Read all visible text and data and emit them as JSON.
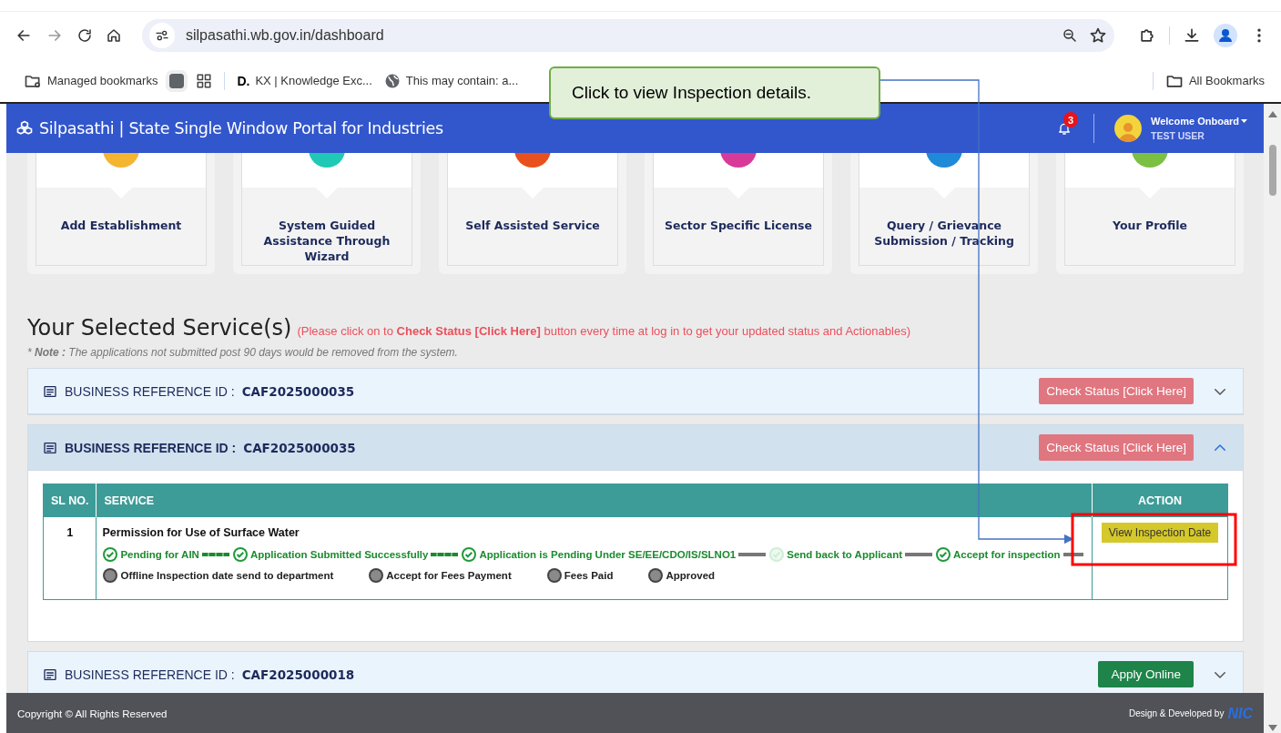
{
  "browser": {
    "url": "silpasathi.wb.gov.in/dashboard",
    "bookmarks": [
      {
        "kind": "managed",
        "label": "Managed bookmarks"
      },
      {
        "kind": "square"
      },
      {
        "kind": "apps"
      },
      {
        "kind": "logo",
        "logo": "D.",
        "label": "KX | Knowledge Exc..."
      },
      {
        "kind": "globe",
        "label": "This may contain: a..."
      }
    ],
    "all_bookmarks": "All Bookmarks"
  },
  "callout": {
    "text": "Click to view Inspection details."
  },
  "header": {
    "title": "Silpasathi | State Single Window Portal for Industries",
    "notifications": "3",
    "welcome": "Welcome Onboard",
    "user": "TEST USER"
  },
  "services": [
    {
      "label": "Add Establishment",
      "color": "#f4b531"
    },
    {
      "label": "System Guided Assistance Through Wizard",
      "color": "#1fc9b5"
    },
    {
      "label": "Self Assisted Service",
      "color": "#e8501e"
    },
    {
      "label": "Sector Specific License",
      "color": "#d83a9a"
    },
    {
      "label": "Query / Grievance Submission / Tracking",
      "color": "#1e8ad8"
    },
    {
      "label": "Your Profile",
      "color": "#7cc043"
    }
  ],
  "selected": {
    "title": "Your Selected Service(s)",
    "hint": "(Please click on to **Check Status [Click Here]** button every time at log in to get your updated status and Actionables)",
    "note": "* **Note :** The applications not submitted post 90 days would be removed from the system."
  },
  "applications": [
    {
      "ref_label": "BUSINESS REFERENCE ID :",
      "ref_id": "CAF2025000035",
      "button": {
        "kind": "check",
        "label": "Check Status [Click Here]"
      },
      "expanded": false
    },
    {
      "ref_label": "BUSINESS REFERENCE ID :",
      "ref_id": "CAF2025000035",
      "button": {
        "kind": "check",
        "label": "Check Status [Click Here]"
      },
      "expanded": true,
      "table": {
        "columns": [
          "SL NO.",
          "SERVICE",
          "ACTION"
        ],
        "rows": [
          {
            "sl": "1",
            "service": "Permission for Use of Surface Water",
            "action": "View Inspection Date",
            "stages": [
              {
                "label": "Pending for AIN",
                "kind": "done"
              },
              {
                "label": "Application Submitted Successfully",
                "kind": "done"
              },
              {
                "label": "Application is Pending Under SE/EE/CDO/IS/SLNO1",
                "kind": "done"
              },
              {
                "label": "Send back to Applicant",
                "kind": "faded"
              },
              {
                "label": "Accept for inspection",
                "kind": "done"
              },
              {
                "label": "Offline Inspection date send to department",
                "kind": "pending"
              },
              {
                "label": "Accept for Fees Payment",
                "kind": "pending"
              },
              {
                "label": "Fees Paid",
                "kind": "pending"
              },
              {
                "label": "Approved",
                "kind": "pending"
              }
            ]
          }
        ]
      }
    },
    {
      "ref_label": "BUSINESS REFERENCE ID :",
      "ref_id": "CAF2025000018",
      "button": {
        "kind": "apply",
        "label": "Apply Online"
      },
      "expanded": false
    }
  ],
  "footer": {
    "copyright": "Copyright © All Rights Reserved",
    "credit": "Design & Developed by",
    "logo": "NIC"
  }
}
